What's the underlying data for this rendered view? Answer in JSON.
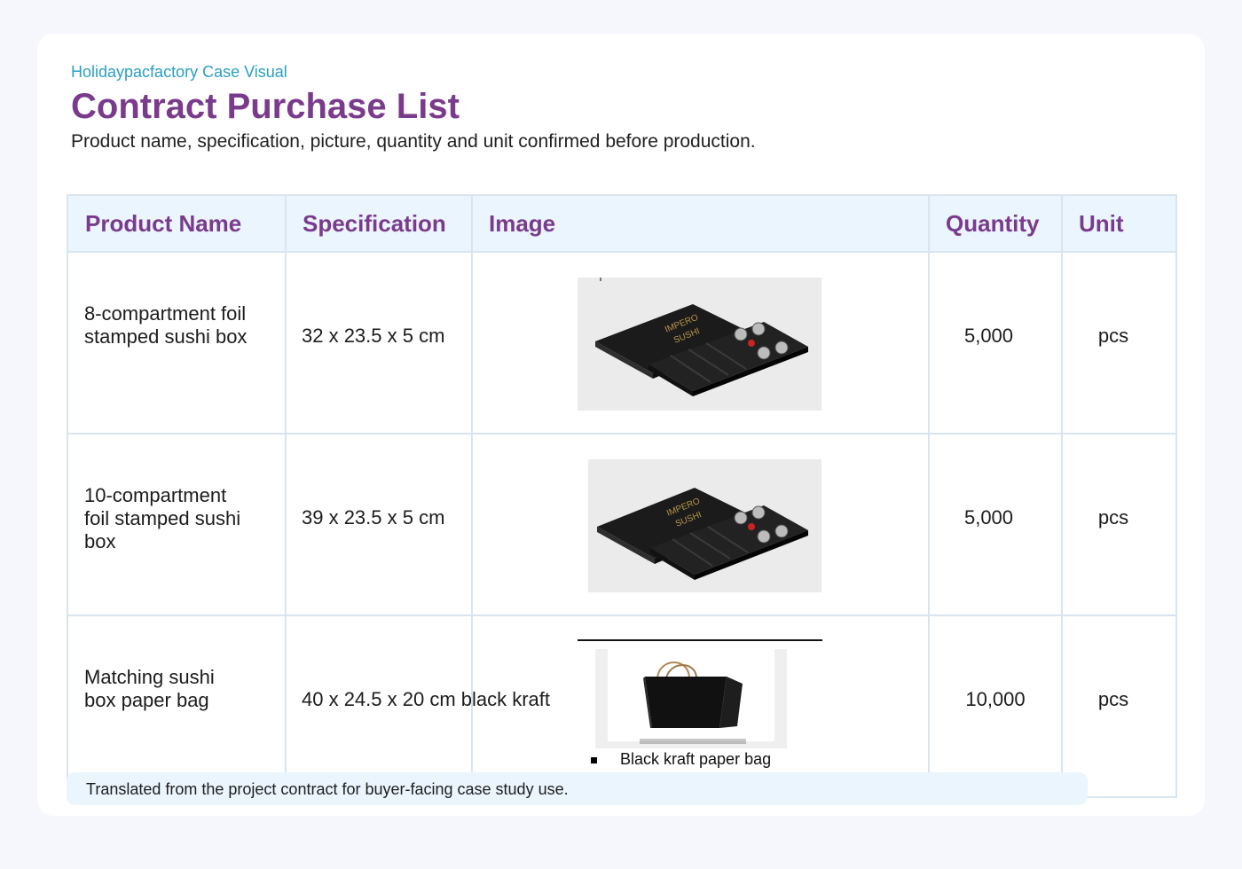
{
  "header": {
    "eyebrow": "Holidaypacfactory Case Visual",
    "title": "Contract Purchase List",
    "subtitle": "Product name, specification, picture, quantity and unit confirmed before production."
  },
  "table": {
    "columns": [
      "Product Name",
      "Specification",
      "Image",
      "Quantity",
      "Unit"
    ],
    "rows": [
      {
        "name_lines": [
          "8-compartment foil",
          "stamped sushi box"
        ],
        "spec": "32 x 23.5 x 5 cm",
        "image": "black-sushi-box-photo",
        "quantity": "5,000",
        "unit": "pcs"
      },
      {
        "name_lines": [
          "10-compartment",
          "foil stamped sushi",
          "box"
        ],
        "spec": "39 x 23.5 x 5 cm",
        "image": "black-sushi-box-photo",
        "quantity": "5,000",
        "unit": "pcs"
      },
      {
        "name_lines": [
          "Matching sushi",
          "box paper bag"
        ],
        "spec": "40 x 24.5 x 20 cm black kraft",
        "image": "black-paper-bag-photo",
        "image_caption": "Black kraft paper bag",
        "quantity": "10,000",
        "unit": "pcs"
      }
    ]
  },
  "footer": {
    "note": "Translated from the project contract for buyer-facing case study use."
  },
  "colors": {
    "accent_purple": "#7a3b8c",
    "eyebrow_blue": "#2a9fc4",
    "header_bg": "#eaf5fd",
    "border": "#d8e5f0",
    "page_bg": "#f5f7fd"
  }
}
